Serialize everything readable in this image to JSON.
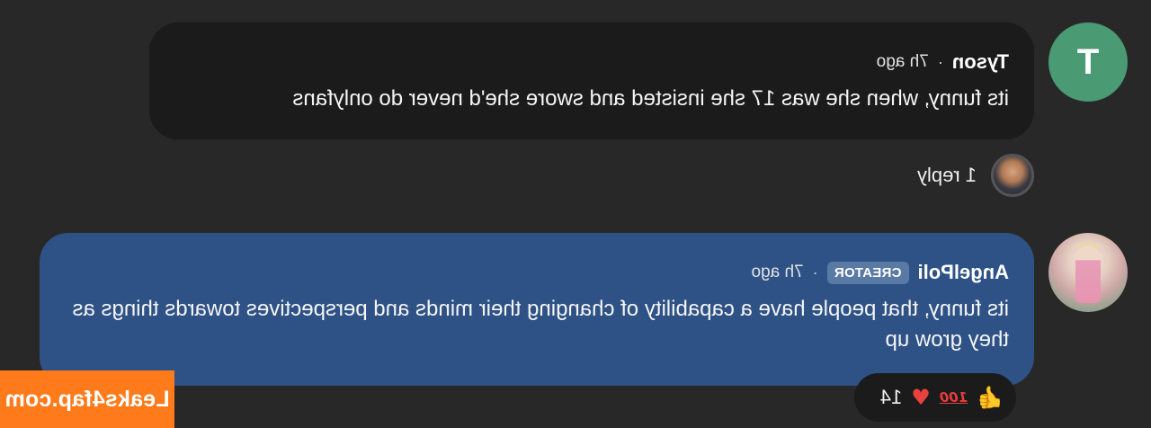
{
  "comments": [
    {
      "avatar_letter": "T",
      "username": "Tyson",
      "separator": "·",
      "time": "7h ago",
      "text": "its funny, when she was 17 she insisted and swore she'd never do onlyfans",
      "replies_label": "1 reply"
    },
    {
      "username": "AngelPoli",
      "badge": "CREATOR",
      "separator": "·",
      "time": "7h ago",
      "text": "its funny, that people have a capability of changing their minds and perspectives towards things as they grow up",
      "reactions": {
        "thumbs_up": "👍",
        "hundred": "100",
        "heart": "♥",
        "count": "14"
      }
    }
  ],
  "watermark": "Leaks4fap.com",
  "colors": {
    "background": "#282828",
    "dark_bubble": "#1b1b1b",
    "creator_bubble": "#2e5286",
    "avatar_green": "#4a9a73",
    "watermark_orange": "#ff7a1a"
  },
  "icons": [
    "thumbs-up-icon",
    "hundred-points-icon",
    "heart-icon"
  ]
}
